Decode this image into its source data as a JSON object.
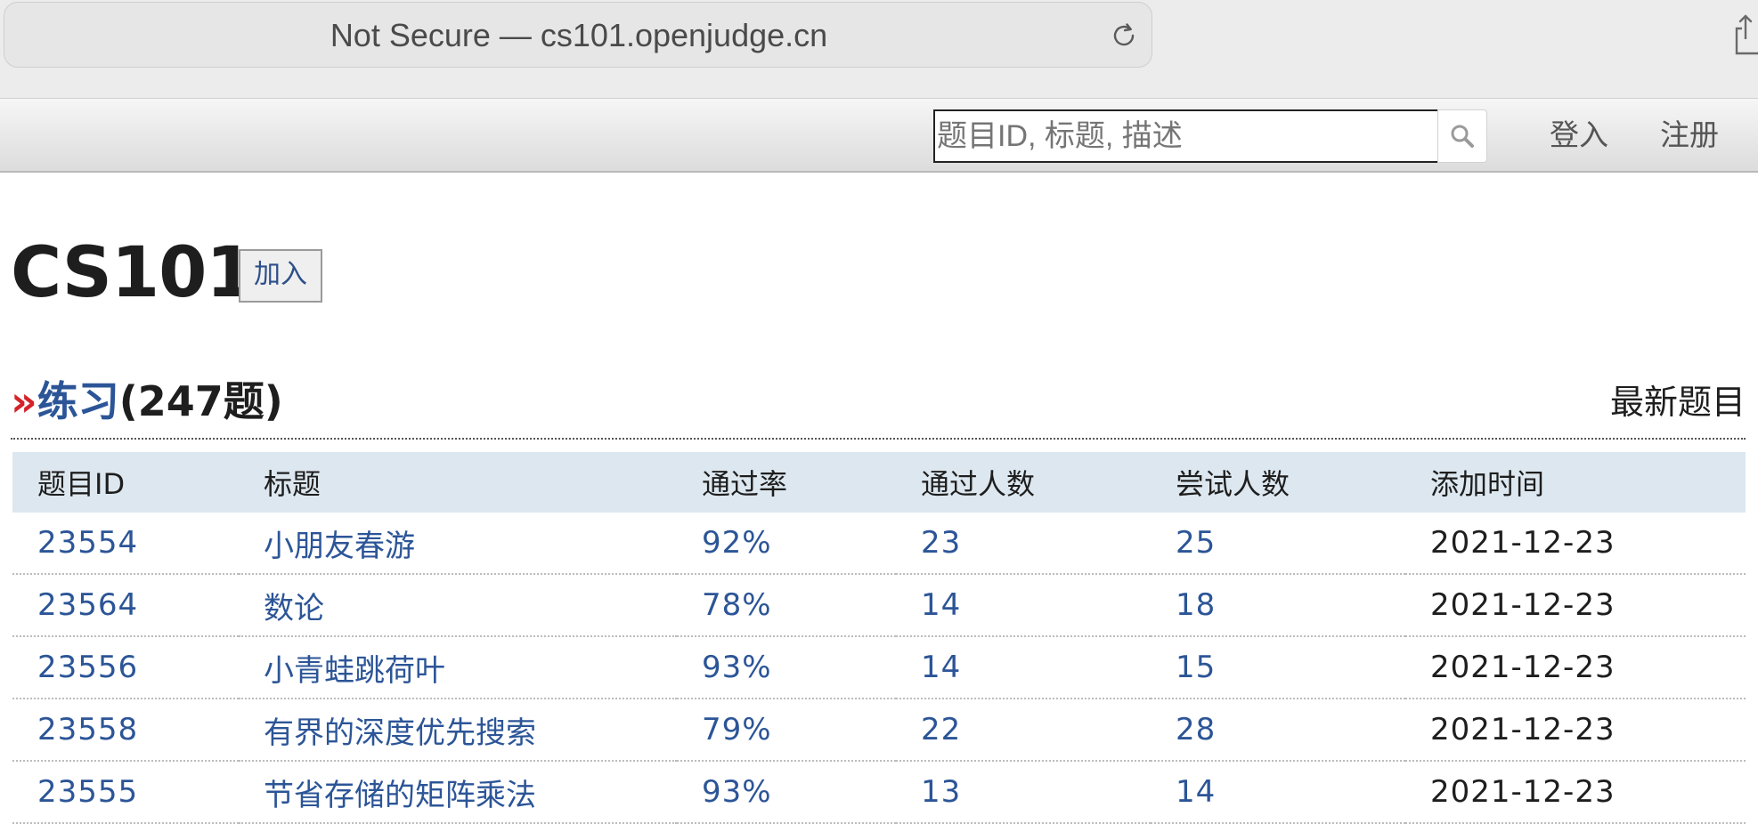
{
  "browser": {
    "address": "Not Secure — cs101.openjudge.cn"
  },
  "navbar": {
    "search_placeholder": "题目ID, 标题, 描述",
    "login_label": "登入",
    "register_label": "注册"
  },
  "course": {
    "title": "CS101",
    "join_label": "加入"
  },
  "section": {
    "marker": "»",
    "name": "练习",
    "count": "(247题)",
    "latest_label": "最新题目"
  },
  "table": {
    "headers": [
      "题目ID",
      "标题",
      "通过率",
      "通过人数",
      "尝试人数",
      "添加时间"
    ],
    "rows": [
      {
        "id": "23554",
        "title": "小朋友春游",
        "pass_rate": "92%",
        "passed": "23",
        "attempted": "25",
        "added": "2021-12-23"
      },
      {
        "id": "23564",
        "title": "数论",
        "pass_rate": "78%",
        "passed": "14",
        "attempted": "18",
        "added": "2021-12-23"
      },
      {
        "id": "23556",
        "title": "小青蛙跳荷叶",
        "pass_rate": "93%",
        "passed": "14",
        "attempted": "15",
        "added": "2021-12-23"
      },
      {
        "id": "23558",
        "title": "有界的深度优先搜索",
        "pass_rate": "79%",
        "passed": "22",
        "attempted": "28",
        "added": "2021-12-23"
      },
      {
        "id": "23555",
        "title": "节省存储的矩阵乘法",
        "pass_rate": "93%",
        "passed": "13",
        "attempted": "14",
        "added": "2021-12-23"
      }
    ]
  }
}
